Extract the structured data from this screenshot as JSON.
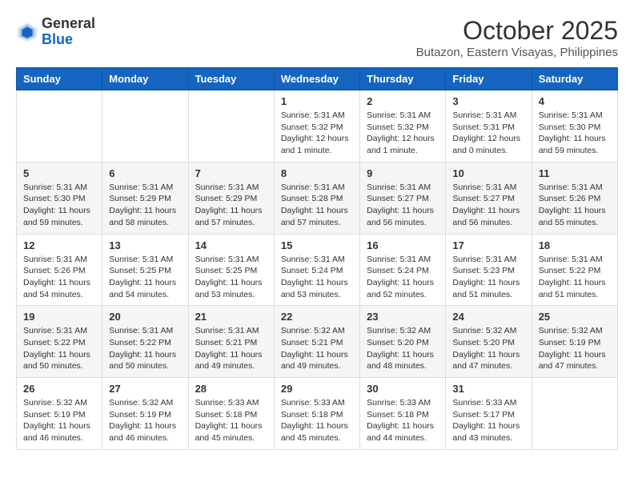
{
  "logo": {
    "general": "General",
    "blue": "Blue"
  },
  "header": {
    "month": "October 2025",
    "location": "Butazon, Eastern Visayas, Philippines"
  },
  "weekdays": [
    "Sunday",
    "Monday",
    "Tuesday",
    "Wednesday",
    "Thursday",
    "Friday",
    "Saturday"
  ],
  "weeks": [
    [
      {
        "day": "",
        "info": ""
      },
      {
        "day": "",
        "info": ""
      },
      {
        "day": "",
        "info": ""
      },
      {
        "day": "1",
        "info": "Sunrise: 5:31 AM\nSunset: 5:32 PM\nDaylight: 12 hours\nand 1 minute."
      },
      {
        "day": "2",
        "info": "Sunrise: 5:31 AM\nSunset: 5:32 PM\nDaylight: 12 hours\nand 1 minute."
      },
      {
        "day": "3",
        "info": "Sunrise: 5:31 AM\nSunset: 5:31 PM\nDaylight: 12 hours\nand 0 minutes."
      },
      {
        "day": "4",
        "info": "Sunrise: 5:31 AM\nSunset: 5:30 PM\nDaylight: 11 hours\nand 59 minutes."
      }
    ],
    [
      {
        "day": "5",
        "info": "Sunrise: 5:31 AM\nSunset: 5:30 PM\nDaylight: 11 hours\nand 59 minutes."
      },
      {
        "day": "6",
        "info": "Sunrise: 5:31 AM\nSunset: 5:29 PM\nDaylight: 11 hours\nand 58 minutes."
      },
      {
        "day": "7",
        "info": "Sunrise: 5:31 AM\nSunset: 5:29 PM\nDaylight: 11 hours\nand 57 minutes."
      },
      {
        "day": "8",
        "info": "Sunrise: 5:31 AM\nSunset: 5:28 PM\nDaylight: 11 hours\nand 57 minutes."
      },
      {
        "day": "9",
        "info": "Sunrise: 5:31 AM\nSunset: 5:27 PM\nDaylight: 11 hours\nand 56 minutes."
      },
      {
        "day": "10",
        "info": "Sunrise: 5:31 AM\nSunset: 5:27 PM\nDaylight: 11 hours\nand 56 minutes."
      },
      {
        "day": "11",
        "info": "Sunrise: 5:31 AM\nSunset: 5:26 PM\nDaylight: 11 hours\nand 55 minutes."
      }
    ],
    [
      {
        "day": "12",
        "info": "Sunrise: 5:31 AM\nSunset: 5:26 PM\nDaylight: 11 hours\nand 54 minutes."
      },
      {
        "day": "13",
        "info": "Sunrise: 5:31 AM\nSunset: 5:25 PM\nDaylight: 11 hours\nand 54 minutes."
      },
      {
        "day": "14",
        "info": "Sunrise: 5:31 AM\nSunset: 5:25 PM\nDaylight: 11 hours\nand 53 minutes."
      },
      {
        "day": "15",
        "info": "Sunrise: 5:31 AM\nSunset: 5:24 PM\nDaylight: 11 hours\nand 53 minutes."
      },
      {
        "day": "16",
        "info": "Sunrise: 5:31 AM\nSunset: 5:24 PM\nDaylight: 11 hours\nand 52 minutes."
      },
      {
        "day": "17",
        "info": "Sunrise: 5:31 AM\nSunset: 5:23 PM\nDaylight: 11 hours\nand 51 minutes."
      },
      {
        "day": "18",
        "info": "Sunrise: 5:31 AM\nSunset: 5:22 PM\nDaylight: 11 hours\nand 51 minutes."
      }
    ],
    [
      {
        "day": "19",
        "info": "Sunrise: 5:31 AM\nSunset: 5:22 PM\nDaylight: 11 hours\nand 50 minutes."
      },
      {
        "day": "20",
        "info": "Sunrise: 5:31 AM\nSunset: 5:22 PM\nDaylight: 11 hours\nand 50 minutes."
      },
      {
        "day": "21",
        "info": "Sunrise: 5:31 AM\nSunset: 5:21 PM\nDaylight: 11 hours\nand 49 minutes."
      },
      {
        "day": "22",
        "info": "Sunrise: 5:32 AM\nSunset: 5:21 PM\nDaylight: 11 hours\nand 49 minutes."
      },
      {
        "day": "23",
        "info": "Sunrise: 5:32 AM\nSunset: 5:20 PM\nDaylight: 11 hours\nand 48 minutes."
      },
      {
        "day": "24",
        "info": "Sunrise: 5:32 AM\nSunset: 5:20 PM\nDaylight: 11 hours\nand 47 minutes."
      },
      {
        "day": "25",
        "info": "Sunrise: 5:32 AM\nSunset: 5:19 PM\nDaylight: 11 hours\nand 47 minutes."
      }
    ],
    [
      {
        "day": "26",
        "info": "Sunrise: 5:32 AM\nSunset: 5:19 PM\nDaylight: 11 hours\nand 46 minutes."
      },
      {
        "day": "27",
        "info": "Sunrise: 5:32 AM\nSunset: 5:19 PM\nDaylight: 11 hours\nand 46 minutes."
      },
      {
        "day": "28",
        "info": "Sunrise: 5:33 AM\nSunset: 5:18 PM\nDaylight: 11 hours\nand 45 minutes."
      },
      {
        "day": "29",
        "info": "Sunrise: 5:33 AM\nSunset: 5:18 PM\nDaylight: 11 hours\nand 45 minutes."
      },
      {
        "day": "30",
        "info": "Sunrise: 5:33 AM\nSunset: 5:18 PM\nDaylight: 11 hours\nand 44 minutes."
      },
      {
        "day": "31",
        "info": "Sunrise: 5:33 AM\nSunset: 5:17 PM\nDaylight: 11 hours\nand 43 minutes."
      },
      {
        "day": "",
        "info": ""
      }
    ]
  ]
}
